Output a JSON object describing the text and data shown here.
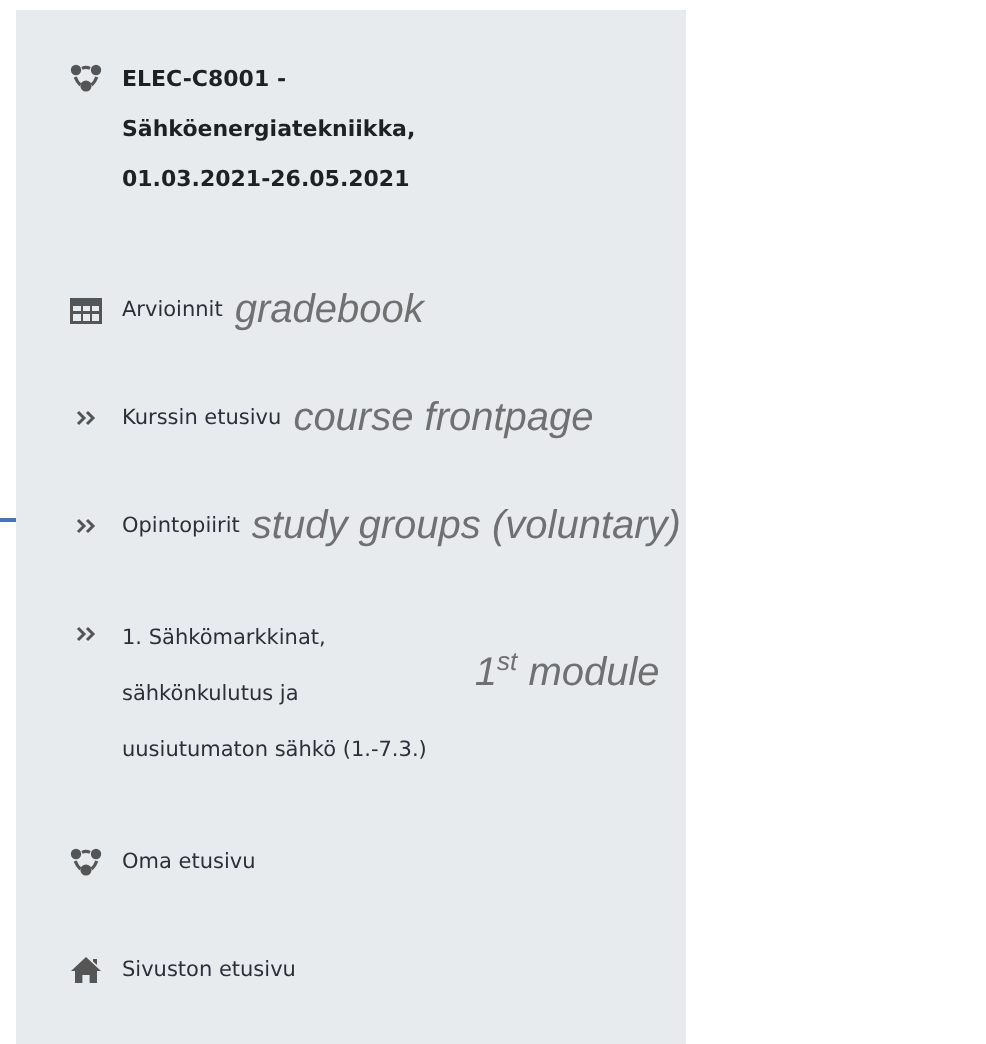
{
  "course": {
    "kind": "network",
    "lines": [
      "ELEC-C8001 -",
      "Sähköenergiatekniikka,",
      "01.03.2021-26.05.2021"
    ]
  },
  "items": [
    {
      "kind": "table",
      "lines": [
        "Arvioinnit"
      ],
      "note": "gradebook"
    },
    {
      "kind": "chevrons",
      "lines": [
        "Kurssin etusivu"
      ],
      "note": "course frontpage"
    },
    {
      "kind": "chevrons",
      "lines": [
        "Opintopiirit"
      ],
      "note": "study groups (voluntary)"
    },
    {
      "kind": "chevrons",
      "lines": [
        "1. Sähkömarkkinat,",
        "sähkönkulutus ja",
        "uusiutumaton sähkö (1.-7.3.)"
      ],
      "note": "1$^{st}$ module"
    },
    {
      "kind": "network",
      "lines": [
        "Oma etusivu"
      ]
    },
    {
      "kind": "home",
      "lines": [
        "Sivuston etusivu"
      ]
    }
  ]
}
